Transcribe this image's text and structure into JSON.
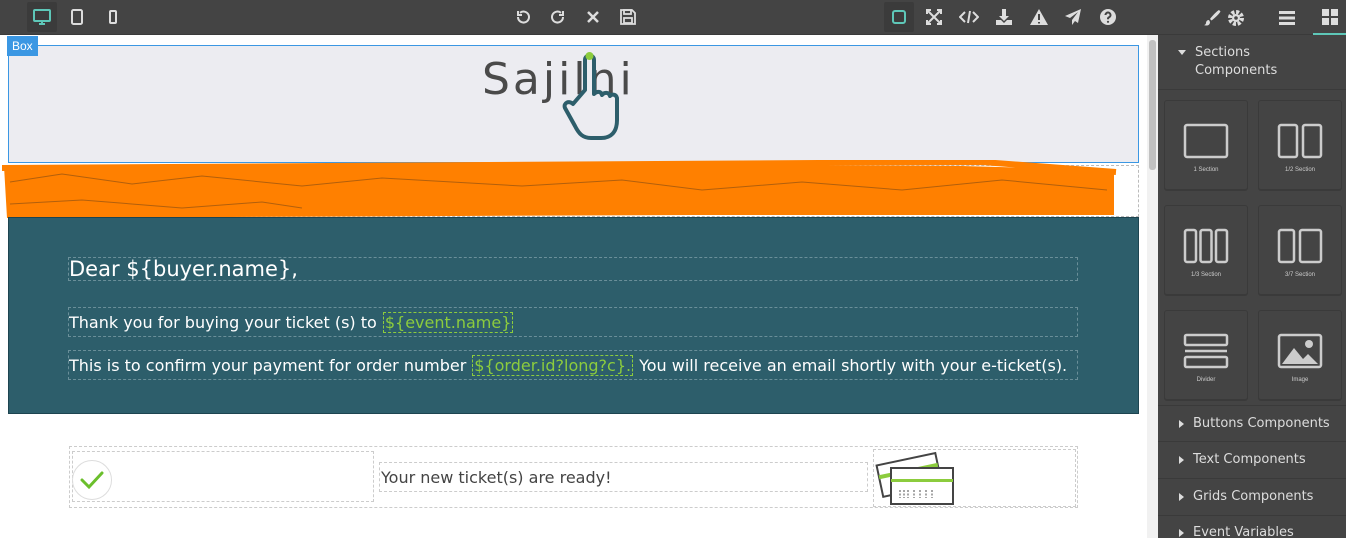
{
  "toolbar": {
    "devices": [
      {
        "name": "desktop-icon",
        "active": true
      },
      {
        "name": "tablet-icon",
        "active": false
      },
      {
        "name": "mobile-icon",
        "active": false
      }
    ],
    "history": [
      "undo-icon",
      "redo-icon",
      "clear-icon",
      "save-icon"
    ],
    "options": [
      "outline-toggle-icon",
      "fullscreen-icon",
      "code-icon",
      "export-icon",
      "warning-icon",
      "send-icon",
      "help-icon"
    ],
    "panels": [
      "brush-icon",
      "gear-icon",
      "layers-icon",
      "blocks-icon"
    ]
  },
  "canvas": {
    "selected_label": "Box",
    "logo_text": "Sajilni",
    "dear": "Dear ${buyer.name},",
    "thanks_prefix": "Thank you for buying your ticket (s) to",
    "event_var": "${event.name}",
    "confirm_prefix": "This is to confirm your payment for order number",
    "order_var": "${order.id?long?c}.",
    "confirm_suffix": "You will receive an email shortly with your e-ticket(s).",
    "ticket_ready": "Your new ticket(s) are ready!"
  },
  "panel": {
    "sections_title": "Sections Components",
    "blocks": [
      {
        "label": "1 Section",
        "icon": "one-section-icon"
      },
      {
        "label": "1/2 Section",
        "icon": "half-section-icon"
      },
      {
        "label": "1/3 Section",
        "icon": "third-section-icon"
      },
      {
        "label": "3/7 Section",
        "icon": "three-seven-section-icon"
      },
      {
        "label": "Divider",
        "icon": "divider-icon"
      },
      {
        "label": "Image",
        "icon": "image-icon"
      }
    ],
    "categories": [
      "Buttons Components",
      "Text Components",
      "Grids Components",
      "Event Variables"
    ]
  },
  "colors": {
    "accent": "#5ec7b8",
    "selection": "#3b97e3",
    "banner": "#2d5e6b",
    "variable": "#8ccc3d",
    "redaction": "#ff8000"
  }
}
